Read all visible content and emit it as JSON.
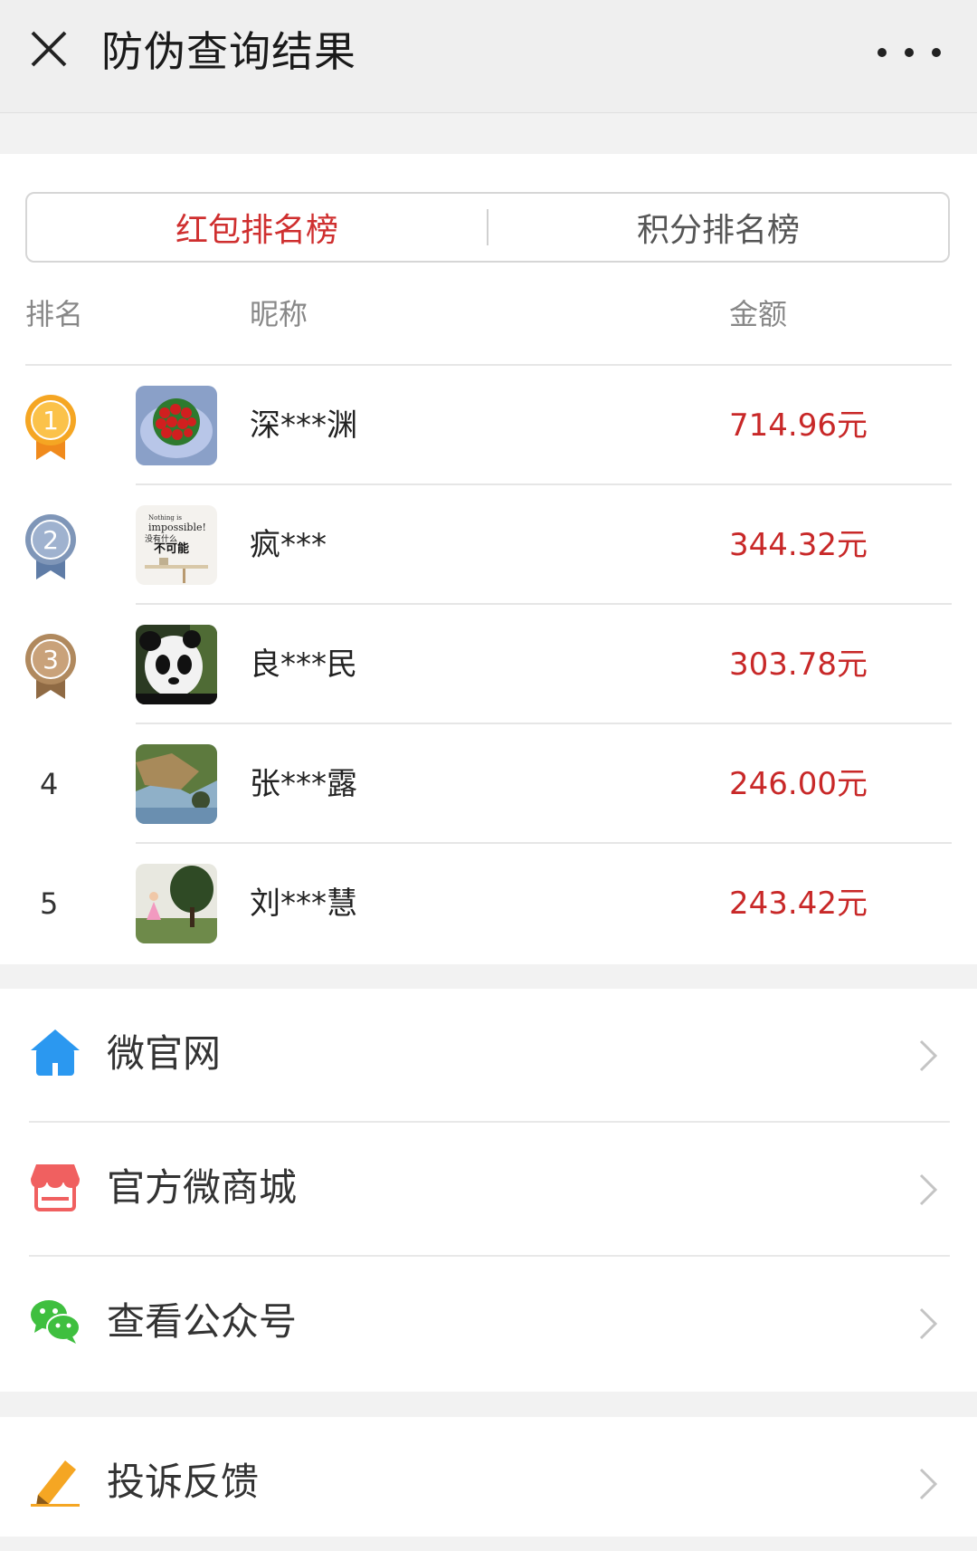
{
  "header": {
    "title": "防伪查询结果",
    "close_icon": "close-icon",
    "more_icon": "more-horizontal-icon"
  },
  "tabs": [
    {
      "label": "红包排名榜",
      "active": true
    },
    {
      "label": "积分排名榜",
      "active": false
    }
  ],
  "columns": {
    "rank": "排名",
    "nickname": "昵称",
    "amount": "金额"
  },
  "rows": [
    {
      "rank": "1",
      "nickname": "深***渊",
      "amount": "714.96元",
      "medal": "gold"
    },
    {
      "rank": "2",
      "nickname": "疯***",
      "amount": "344.32元",
      "medal": "silver"
    },
    {
      "rank": "3",
      "nickname": "良***民",
      "amount": "303.78元",
      "medal": "bronze"
    },
    {
      "rank": "4",
      "nickname": "张***露",
      "amount": "246.00元"
    },
    {
      "rank": "5",
      "nickname": "刘***慧",
      "amount": "243.42元"
    }
  ],
  "avatar_texts": {
    "row2_line1": "Nothing is",
    "row2_line2": "impossible!",
    "row2_line3": "没有什么",
    "row2_line4": "不可能"
  },
  "menu": [
    {
      "label": "微官网",
      "icon": "home-icon"
    },
    {
      "label": "官方微商城",
      "icon": "shop-icon"
    },
    {
      "label": "查看公众号",
      "icon": "wechat-icon"
    }
  ],
  "menu2": [
    {
      "label": "投诉反馈",
      "icon": "pencil-icon"
    }
  ],
  "colors": {
    "active_tab": "#cf2f2f",
    "amount": "#c82828",
    "gold": "#f5a623",
    "silver": "#7f96b8",
    "bronze": "#b0895e",
    "home": "#2b98f0",
    "shop": "#f06060",
    "wechat": "#3fbf3f",
    "pencil": "#f5a623"
  }
}
